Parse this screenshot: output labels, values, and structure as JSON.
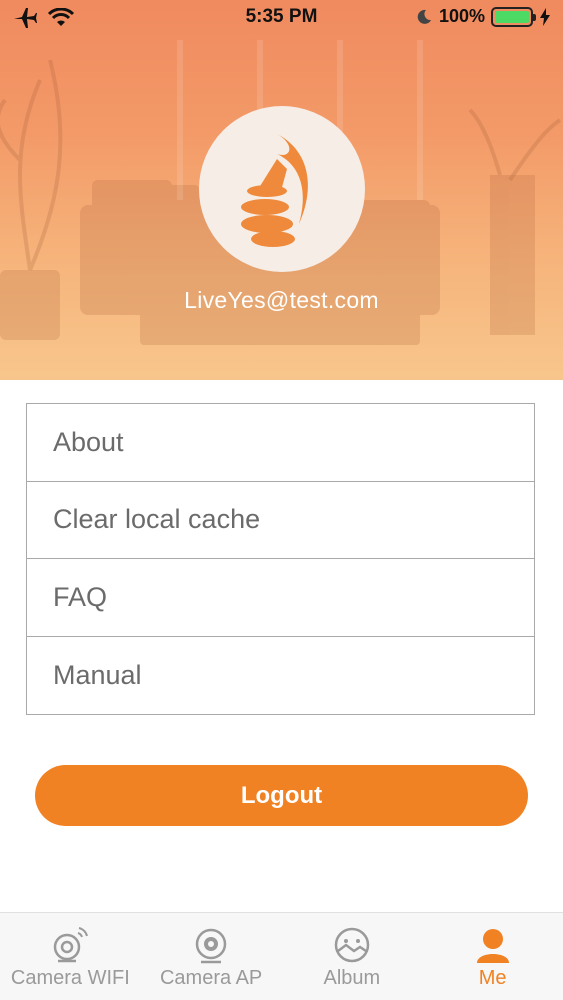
{
  "status_bar": {
    "time": "5:35 PM",
    "battery_percent": "100%",
    "battery_level": 1.0,
    "icons": [
      "airplane-icon",
      "wifi-icon",
      "moon-icon",
      "battery-icon",
      "charging-bolt-icon"
    ]
  },
  "profile": {
    "email": "LiveYes@test.com",
    "avatar_icon": "thumbs-up-flame-logo-icon"
  },
  "menu": {
    "items": [
      {
        "label": "About"
      },
      {
        "label": "Clear local cache"
      },
      {
        "label": "FAQ"
      },
      {
        "label": "Manual"
      }
    ]
  },
  "actions": {
    "logout_label": "Logout"
  },
  "tabbar": {
    "tabs": [
      {
        "label": "Camera WIFI",
        "icon": "camera-wifi-icon",
        "active": false
      },
      {
        "label": "Camera AP",
        "icon": "camera-ap-icon",
        "active": false
      },
      {
        "label": "Album",
        "icon": "album-icon",
        "active": false
      },
      {
        "label": "Me",
        "icon": "person-icon",
        "active": true
      }
    ]
  },
  "colors": {
    "accent": "#f08224",
    "header_top": "#f08a5f",
    "header_bottom": "#f8c68c",
    "tab_inactive": "#9a9a9a",
    "menu_text": "#6b6b6b",
    "battery_green": "#4cd964"
  }
}
